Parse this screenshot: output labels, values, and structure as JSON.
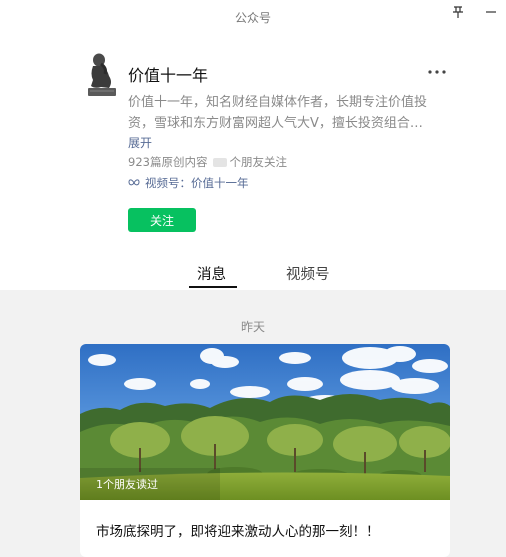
{
  "window": {
    "title": "公众号"
  },
  "profile": {
    "name": "价值十一年",
    "description": "价值十一年，知名财经自媒体作者，长期专注价值投资，雪球和东方财富网超人气大V，擅长投资组合…",
    "expand_label": "展开",
    "articles_count": "923篇原创内容",
    "friends_follow": "个朋友关注",
    "channel_label": "视频号：价值十一年",
    "follow_label": "关注"
  },
  "tabs": [
    {
      "label": "消息",
      "active": true
    },
    {
      "label": "视频号",
      "active": false
    }
  ],
  "feed": {
    "date_label": "昨天",
    "articles": [
      {
        "read_by": "1个朋友读过",
        "title": "市场底探明了，即将迎来激动人心的那一刻！！",
        "image": "landscape-trees-sky"
      }
    ]
  },
  "colors": {
    "accent_green": "#07c160",
    "link_blue": "#576b95",
    "feed_background": "#f2f2f2"
  }
}
